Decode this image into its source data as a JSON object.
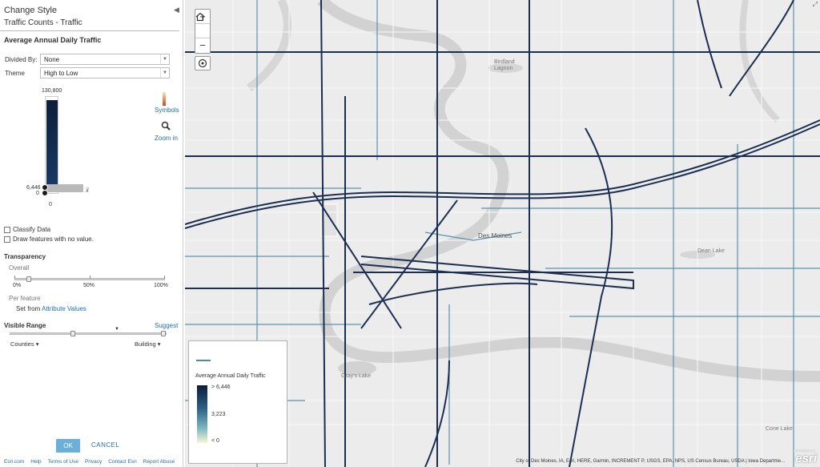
{
  "panel": {
    "title": "Change Style",
    "layer_name": "Traffic Counts - Traffic",
    "collapse_icon": "chevron-left-icon",
    "attribute_title": "Average Annual Daily Traffic",
    "divided_by": {
      "label": "Divided By:",
      "value": "None"
    },
    "theme": {
      "label": "Theme",
      "value": "High to Low"
    },
    "histogram": {
      "max_label": "130,800",
      "handle_label": "6,446",
      "min_label": "0",
      "bottom_label": "0",
      "average_symbol": "x̄",
      "symbols_link": "Symbols",
      "zoom_link": "Zoom in"
    },
    "classify_label": "Classify Data",
    "no_value_label": "Draw features with no value.",
    "transparency": {
      "title": "Transparency",
      "overall_label": "Overall",
      "ticks": [
        "0%",
        "50%",
        "100%"
      ],
      "per_feature_label": "Per feature",
      "set_from_prefix": "Set from",
      "set_from_link": "Attribute Values"
    },
    "visible_range": {
      "title": "Visible Range",
      "suggest": "Suggest",
      "min_option": "Counties",
      "max_option": "Building"
    },
    "ok_label": "OK",
    "cancel_label": "CANCEL",
    "footer_links": [
      "Esri.com",
      "Help",
      "Terms of Use",
      "Privacy",
      "Contact Esri",
      "Report Abuse"
    ]
  },
  "map": {
    "zoom_in": "+",
    "zoom_out": "−",
    "home_icon": "home-icon",
    "locate_icon": "locate-icon",
    "labels": {
      "city": "Des Moines",
      "birdland_lagoon": "Birdland\nLagoon",
      "dean_lake": "Dean Lake",
      "grays_lake": "Gray's Lake",
      "cone_lake": "Cone Lake"
    },
    "legend": {
      "title": "Average Annual Daily Traffic",
      "high": "> 6,446",
      "mid": "3,223",
      "low": "< 0"
    },
    "attribution": "City of Des Moines, IA, Esri, HERE, Garmin, INCREMENT P, USGS, EPA, NPS, US Census Bureau, USDA | Iowa Departme...",
    "powered_by": "POWERED BY",
    "logo_text": "esri",
    "colors": {
      "road_dark": "#1b2f52",
      "road_light": "#5b93ab",
      "river": "#cfcfcf",
      "map_bg": "#ececec"
    }
  }
}
